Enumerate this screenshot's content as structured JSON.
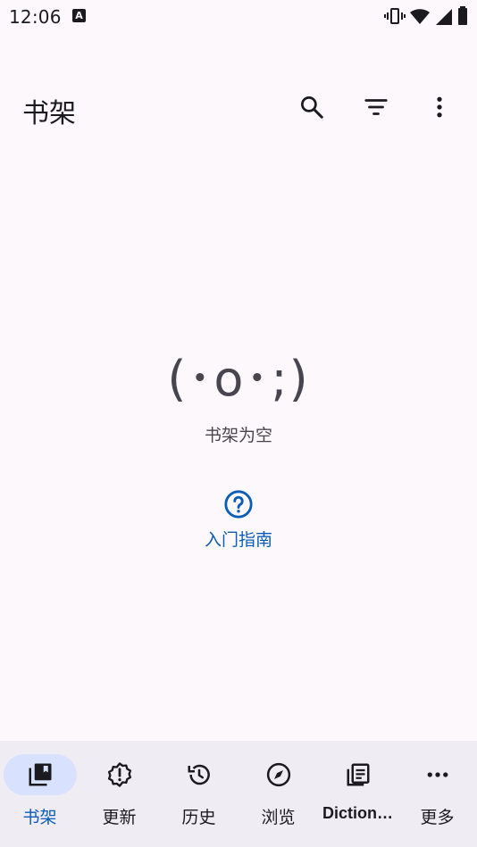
{
  "status_bar": {
    "time": "12:06",
    "notification_letter": "A"
  },
  "header": {
    "title": "书架",
    "actions": [
      "search-icon",
      "filter-icon",
      "more-vert-icon"
    ]
  },
  "empty_state": {
    "face": "(･o･;)",
    "message": "书架为空",
    "guide_label": "入门指南"
  },
  "bottom_nav": {
    "items": [
      {
        "label": "书架",
        "icon": "library-icon",
        "active": true
      },
      {
        "label": "更新",
        "icon": "alert-badge-icon",
        "active": false
      },
      {
        "label": "历史",
        "icon": "history-icon",
        "active": false
      },
      {
        "label": "浏览",
        "icon": "compass-icon",
        "active": false
      },
      {
        "label": "Diction…",
        "icon": "dictionary-icon",
        "active": false
      },
      {
        "label": "更多",
        "icon": "more-horiz-icon",
        "active": false
      }
    ]
  },
  "colors": {
    "accent": "#0a5cb8",
    "active_pill": "#d8e2ff",
    "nav_background": "#f0ecf4",
    "background": "#fcf8fc"
  }
}
